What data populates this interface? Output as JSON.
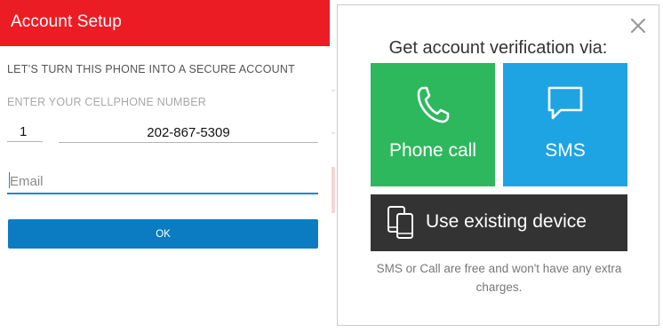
{
  "app_bar": {
    "title": "Account Setup"
  },
  "setup": {
    "intro": "LET’S TURN THIS PHONE INTO A SECURE ACCOUNT",
    "phone_label": "ENTER YOUR CELLPHONE NUMBER",
    "country_code": "1",
    "phone_number": "202-867-5309",
    "email_placeholder": "Email",
    "ok_label": "OK"
  },
  "dialog": {
    "title": "Get account verification via:",
    "options": [
      {
        "label": "Phone call",
        "icon": "phone-icon",
        "color": "#2eb85e"
      },
      {
        "label": "SMS",
        "icon": "chat-bubble-icon",
        "color": "#1ea4e3"
      },
      {
        "label": "Use existing device",
        "icon": "devices-icon",
        "color": "#333333"
      }
    ],
    "footnote": "SMS or Call are free and won't have any extra charges."
  },
  "colors": {
    "app_bar": "#ec1c24",
    "ok_button": "#0b7cc1",
    "email_focus": "#1e88c9"
  }
}
